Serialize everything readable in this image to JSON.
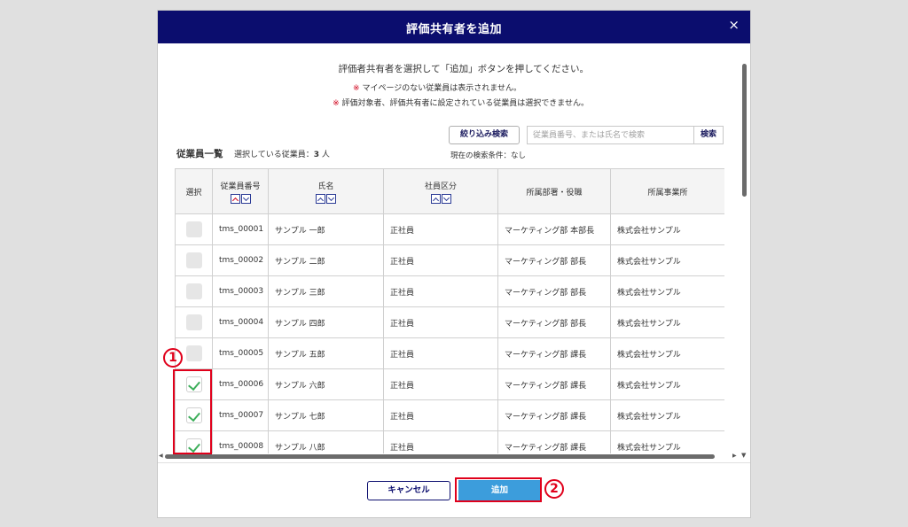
{
  "dialog": {
    "title": "評価共有者を追加",
    "close_icon": "×"
  },
  "instructions": {
    "main": "評価者共有者を選択して「追加」ボタンを押してください。",
    "mark": "※",
    "note1": " マイページのない従業員は表示されません。",
    "note2": " 評価対象者、評価共有者に設定されている従業員は選択できません。"
  },
  "list": {
    "title": "従業員一覧",
    "selected_label": "選択している従業員：",
    "selected_count": "3",
    "selected_unit": " 人"
  },
  "search": {
    "filter_label": "絞り込み検索",
    "placeholder": "従業員番号、または氏名で検索",
    "button_label": "検索",
    "current_condition": "現在の検索条件：なし"
  },
  "table": {
    "headers": {
      "select": "選択",
      "emp_no": "従業員番号",
      "name": "氏名",
      "category": "社員区分",
      "dept": "所属部署・役職",
      "office": "所属事業所"
    },
    "rows": [
      {
        "checked": false,
        "emp_no": "tms_00001",
        "name": "サンプル 一郎",
        "category": "正社員",
        "dept": "マーケティング部 本部長",
        "office": "株式会社サンプル"
      },
      {
        "checked": false,
        "emp_no": "tms_00002",
        "name": "サンプル 二郎",
        "category": "正社員",
        "dept": "マーケティング部 部長",
        "office": "株式会社サンプル"
      },
      {
        "checked": false,
        "emp_no": "tms_00003",
        "name": "サンプル 三郎",
        "category": "正社員",
        "dept": "マーケティング部 部長",
        "office": "株式会社サンプル"
      },
      {
        "checked": false,
        "emp_no": "tms_00004",
        "name": "サンプル 四郎",
        "category": "正社員",
        "dept": "マーケティング部 部長",
        "office": "株式会社サンプル"
      },
      {
        "checked": false,
        "emp_no": "tms_00005",
        "name": "サンプル 五郎",
        "category": "正社員",
        "dept": "マーケティング部 課長",
        "office": "株式会社サンプル"
      },
      {
        "checked": true,
        "emp_no": "tms_00006",
        "name": "サンプル 六郎",
        "category": "正社員",
        "dept": "マーケティング部 課長",
        "office": "株式会社サンプル"
      },
      {
        "checked": true,
        "emp_no": "tms_00007",
        "name": "サンプル 七郎",
        "category": "正社員",
        "dept": "マーケティング部 課長",
        "office": "株式会社サンプル"
      },
      {
        "checked": true,
        "emp_no": "tms_00008",
        "name": "サンプル 八郎",
        "category": "正社員",
        "dept": "マーケティング部 課長",
        "office": "株式会社サンプル"
      }
    ]
  },
  "footer": {
    "cancel_label": "キャンセル",
    "add_label": "追加"
  },
  "annotations": {
    "callout1": "1",
    "callout2": "2",
    "accent_color": "#e0001b"
  },
  "colors": {
    "header_bg": "#0b0d6e",
    "add_button": "#3c9ddc",
    "check_green": "#3cae5a"
  }
}
